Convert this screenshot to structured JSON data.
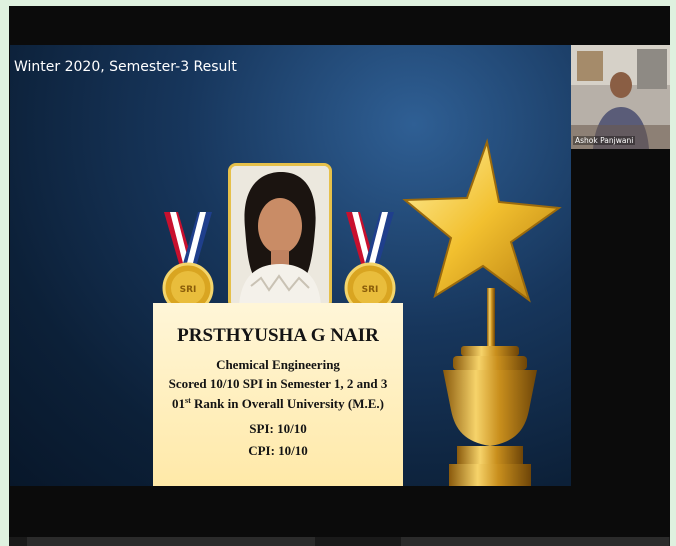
{
  "slide": {
    "title": "Winter 2020, Semester-3 Result",
    "student_name": "PRSTHYUSHA G NAIR",
    "department": "Chemical Engineering",
    "line_scored": "Scored 10/10 SPI in Semester 1, 2 and 3",
    "rank_prefix": "01",
    "rank_suffix": "st",
    "rank_rest": " Rank in Overall University (M.E.)",
    "spi": "SPI: 10/10",
    "cpi": "CPI: 10/10",
    "medal_label": "SRI"
  },
  "webcam": {
    "participant_name": "Ashok Panjwani"
  },
  "colors": {
    "slide_bg": "#17365c",
    "gold": "#e6c04a",
    "plaque": "#fff3c4"
  }
}
